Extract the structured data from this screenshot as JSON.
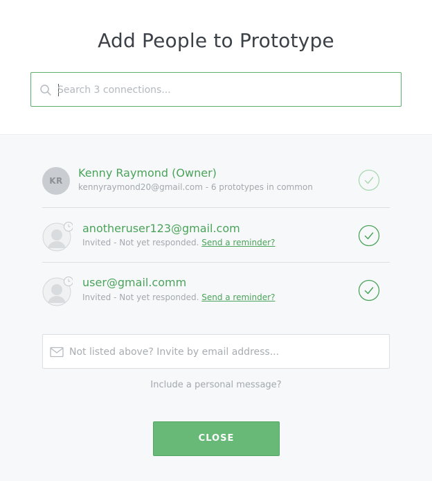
{
  "dialog": {
    "title": "Add People to Prototype"
  },
  "search": {
    "placeholder": "Search 3 connections..."
  },
  "people": [
    {
      "initials": "KR",
      "name": "Kenny Raymond (Owner)",
      "subtitle": "kennyraymond20@gmail.com - 6 prototypes in common",
      "selected": true
    },
    {
      "name": "anotheruser123@gmail.com",
      "status": "Invited - Not yet responded.",
      "reminder_link": "Send a reminder?",
      "selected": true
    },
    {
      "name": "user@gmail.comm",
      "status": "Invited - Not yet responded.",
      "reminder_link": "Send a reminder?",
      "selected": true
    }
  ],
  "invite": {
    "placeholder": "Not listed above? Invite by email address..."
  },
  "personal_message_link": "Include a personal message?",
  "close_label": "CLOSE",
  "colors": {
    "accent": "#4aa35a",
    "button": "#68b978",
    "muted": "#a2a8ae",
    "panel": "#f7f8f9"
  }
}
